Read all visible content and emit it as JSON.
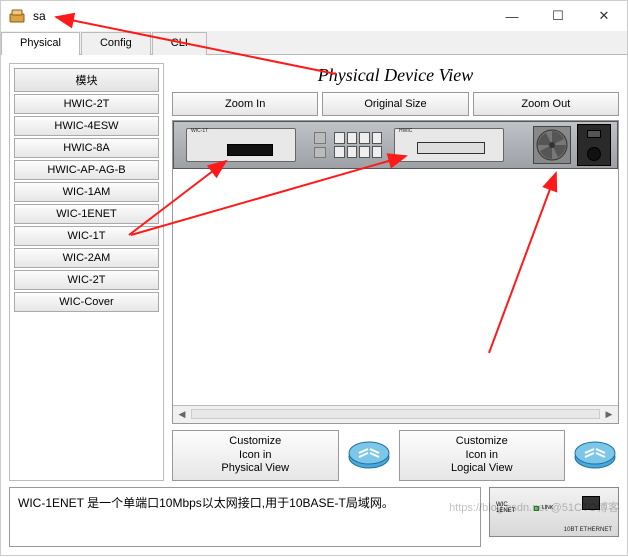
{
  "window": {
    "title": "sa"
  },
  "tabs": {
    "physical": "Physical",
    "config": "Config",
    "cli": "CLI"
  },
  "modules": {
    "header": "模块",
    "items": [
      "HWIC-2T",
      "HWIC-4ESW",
      "HWIC-8A",
      "HWIC-AP-AG-B",
      "WIC-1AM",
      "WIC-1ENET",
      "WIC-1T",
      "WIC-2AM",
      "WIC-2T",
      "WIC-Cover"
    ]
  },
  "physical_view": {
    "title": "Physical Device View",
    "zoom_in": "Zoom In",
    "original": "Original Size",
    "zoom_out": "Zoom Out",
    "customize_physical": "Customize\nIcon in\nPhysical View",
    "customize_logical": "Customize\nIcon in\nLogical View"
  },
  "description": "WIC-1ENET 是一个单端口10Mbps以太网接口,用于10BASE-T局域网。",
  "thumb": {
    "port_label": "10BT ETHERNET",
    "link": "LINK",
    "wic": "WIC\n1ENET"
  },
  "watermark": "https://blog.csdn.net   @51CTO博客"
}
